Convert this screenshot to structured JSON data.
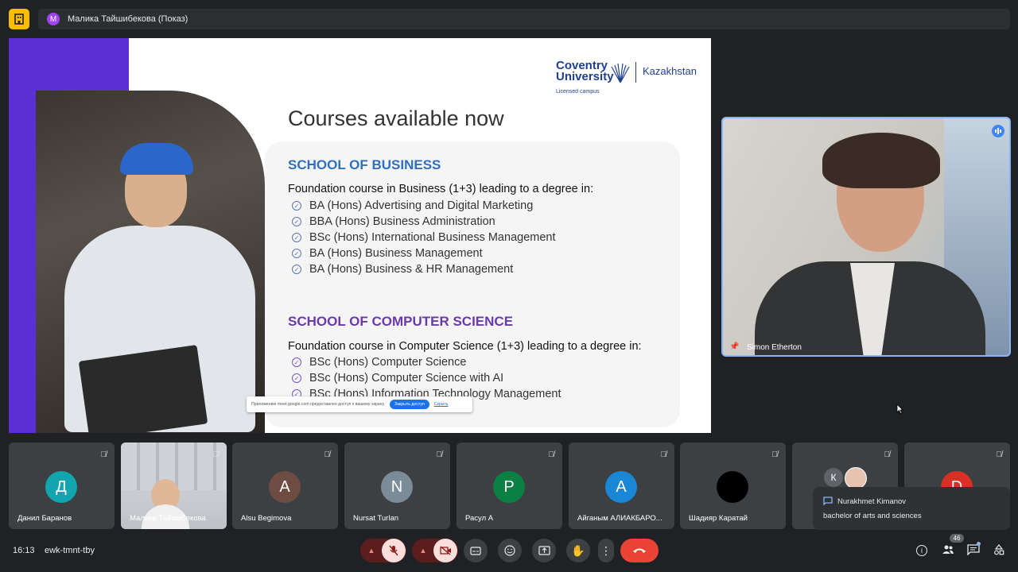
{
  "top_bar": {
    "presenter_initial": "М",
    "presenter_label": "Малика Тайшибекова (Показ)"
  },
  "slide": {
    "logo_brand_line1": "Coventry",
    "logo_brand_line2": "University",
    "logo_region": "Kazakhstan",
    "logo_tagline": "Licensed campus",
    "title": "Courses available now",
    "schools": [
      {
        "name": "SCHOOL OF BUSINESS",
        "intro": "Foundation course in Business (1+3) leading to a degree in:",
        "courses": [
          "BA (Hons) Advertising and Digital Marketing",
          "BBA (Hons) Business Administration",
          "BSc (Hons) International Business Management",
          "BA (Hons) Business Management",
          "BA (Hons) Business & HR Management"
        ]
      },
      {
        "name": "SCHOOL OF COMPUTER SCIENCE",
        "intro": "Foundation course in Computer Science (1+3) leading to a degree in:",
        "courses": [
          "BSc (Hons) Computer Science",
          "BSc (Hons) Computer Science with AI",
          "BSc (Hons) Information Technology Management"
        ]
      }
    ],
    "share_banner": {
      "text": "Приложению meet.google.com предоставлен доступ к вашему экрану.",
      "stop_button": "Закрыть доступ",
      "hide_link": "Скрыть"
    }
  },
  "speaker": {
    "name": "Simon Etherton"
  },
  "participants": [
    {
      "name": "Данил Баранов",
      "initial": "Д",
      "color": "#12a4af"
    },
    {
      "name": "Малика Тайшибекова",
      "initial": "",
      "color": ""
    },
    {
      "name": "Alsu Begimova",
      "initial": "A",
      "color": "#6d4c41"
    },
    {
      "name": "Nursat Turlan",
      "initial": "N",
      "color": "#7b8b98"
    },
    {
      "name": "Расул А",
      "initial": "Р",
      "color": "#0b8043"
    },
    {
      "name": "Айганым АЛИАКБАРО...",
      "initial": "А",
      "color": "#1a86d6"
    },
    {
      "name": "Шадияр Каратай",
      "initial": "",
      "color": "#000000"
    },
    {
      "name": "",
      "initial": "К",
      "color": "#5f6368"
    },
    {
      "name": "",
      "initial": "D",
      "color": "#d93025"
    }
  ],
  "chat_toast": {
    "sender": "Nurakhmet Kimanov",
    "message": "bachelor of arts and sciences"
  },
  "bottom_bar": {
    "time": "16:13",
    "meeting_code": "ewk-tmnt-tby",
    "participant_count": "46"
  }
}
